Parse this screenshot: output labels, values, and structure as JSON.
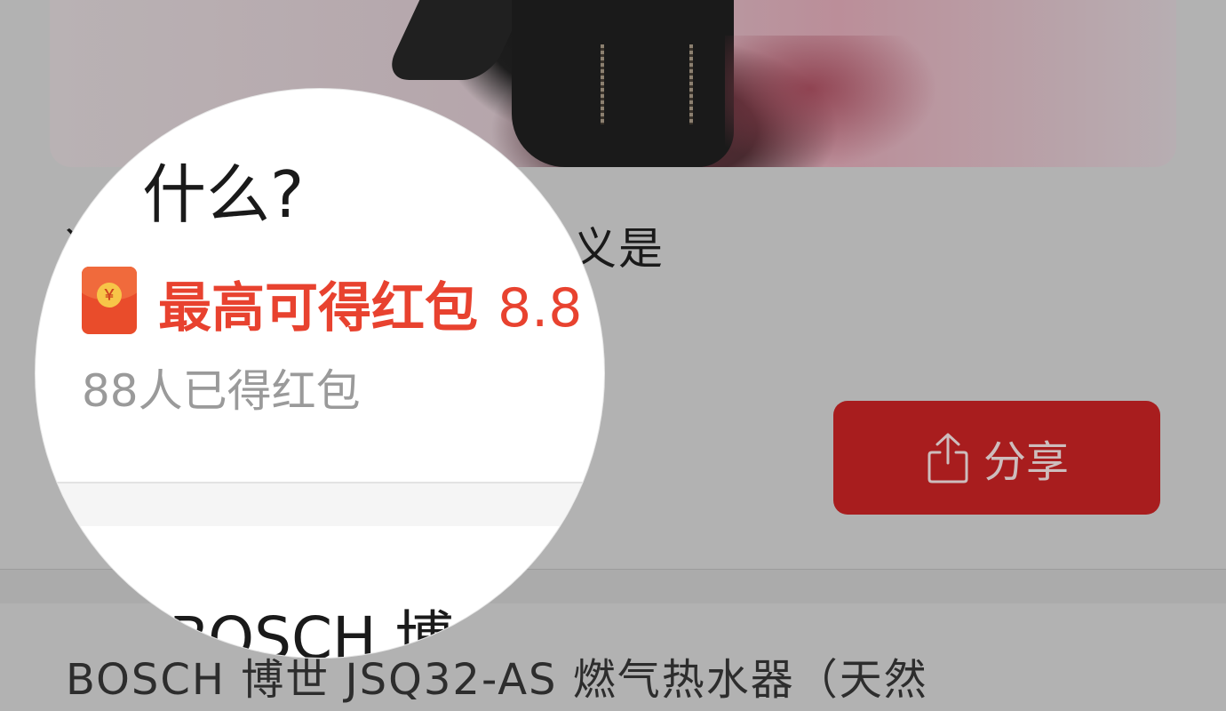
{
  "article": {
    "heading": "这首歌所讲述的意义是什义是"
  },
  "share_button": {
    "label": "分享",
    "icon": "share-icon"
  },
  "product": {
    "title": "BOSCH  博世  JSQ32-AS  燃气热水器（天然"
  },
  "magnifier": {
    "partial_heading": "什么?",
    "red_packet": {
      "icon": "red-packet-icon",
      "coin_symbol": "￥",
      "label": "最高可得红包",
      "amount": "8.8"
    },
    "claimed_text": "88人已得红包",
    "partial_product": "BOSCH  博"
  },
  "colors": {
    "share_button_bg": "#a81d1e",
    "reward_red": "#e8422f",
    "overlay_gray": "#b2b2b2"
  }
}
